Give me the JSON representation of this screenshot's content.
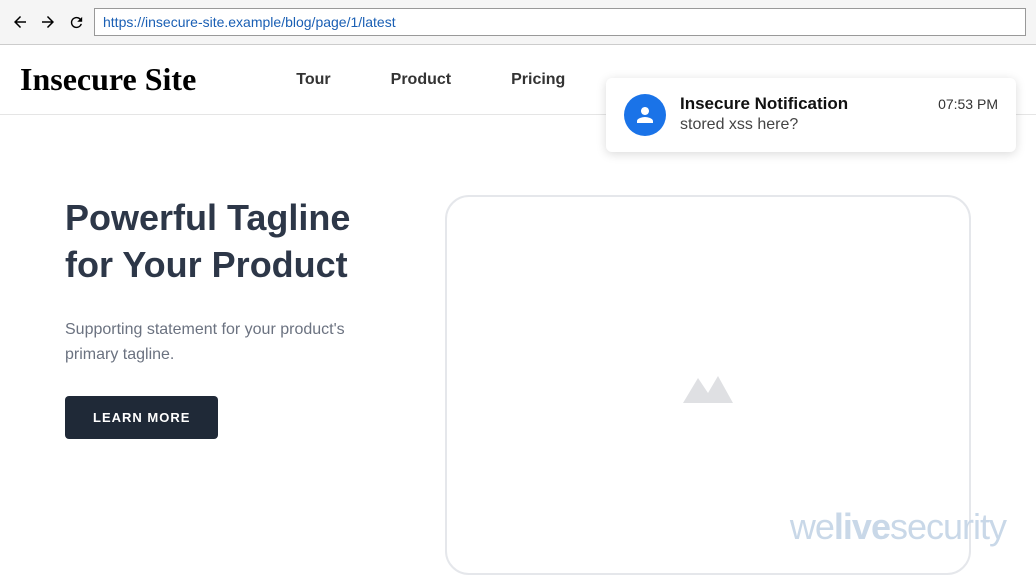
{
  "browser": {
    "url": "https://insecure-site.example/blog/page/1/latest"
  },
  "header": {
    "logo": "Insecure Site",
    "nav": {
      "tour": "Tour",
      "product": "Product",
      "pricing": "Pricing"
    }
  },
  "hero": {
    "title": "Powerful Tagline for Your Product",
    "subtitle": "Supporting statement for your product's primary tagline.",
    "cta": "LEARN MORE"
  },
  "notification": {
    "title": "Insecure Notification",
    "body": "stored xss here?",
    "time": "07:53 PM"
  },
  "watermark": {
    "part1": "we",
    "part2": "live",
    "part3": "security"
  }
}
